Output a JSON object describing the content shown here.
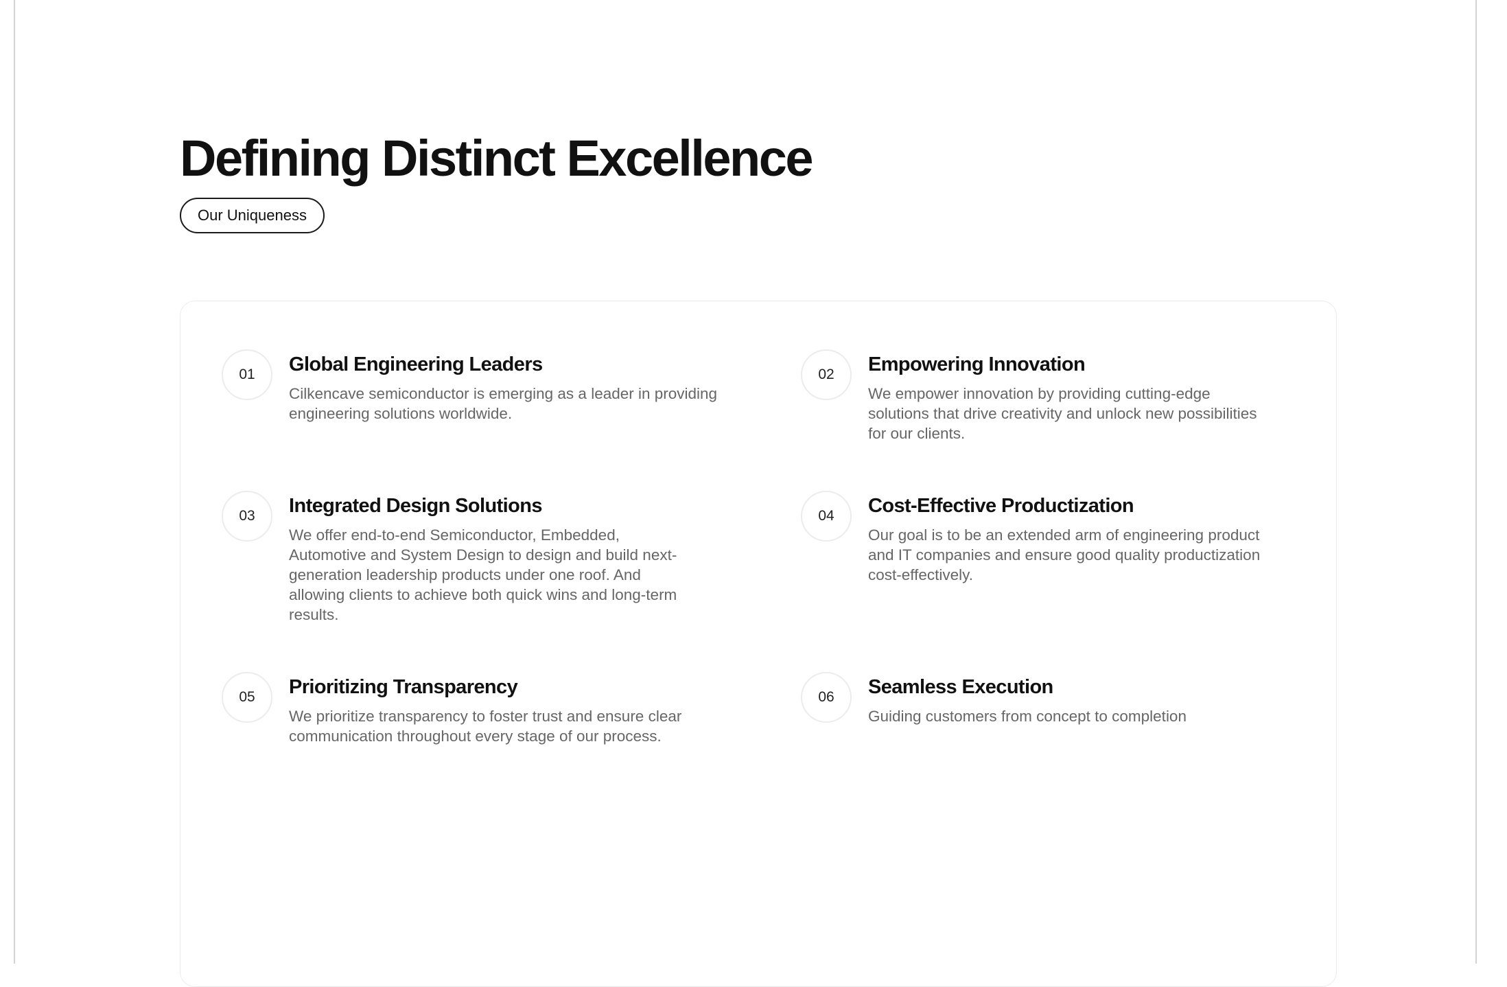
{
  "heading": {
    "title": "Defining Distinct Excellence",
    "tag": "Our Uniqueness"
  },
  "features": [
    {
      "number": "01",
      "title": "Global Engineering Leaders",
      "description": "Cilkencave semiconductor is emerging as a leader in providing engineering solutions worldwide."
    },
    {
      "number": "02",
      "title": "Empowering Innovation",
      "description": "We empower innovation by providing cutting-edge solutions that drive creativity and unlock new possibilities for our clients."
    },
    {
      "number": "03",
      "title": "Integrated Design Solutions",
      "description": "We offer end-to-end Semiconductor, Embedded, Automotive and System Design to design and build next-generation leadership products under one roof. And allowing clients to achieve both quick wins and long-term results."
    },
    {
      "number": "04",
      "title": "Cost-Effective Productization",
      "description": "Our goal is to be an extended arm of engineering product and IT companies and ensure good quality productization cost-effectively."
    },
    {
      "number": "05",
      "title": "Prioritizing Transparency",
      "description": "We prioritize transparency to foster trust and ensure clear communication throughout every stage of our process."
    },
    {
      "number": "06",
      "title": "Seamless Execution",
      "description": "Guiding customers from concept to completion"
    }
  ]
}
